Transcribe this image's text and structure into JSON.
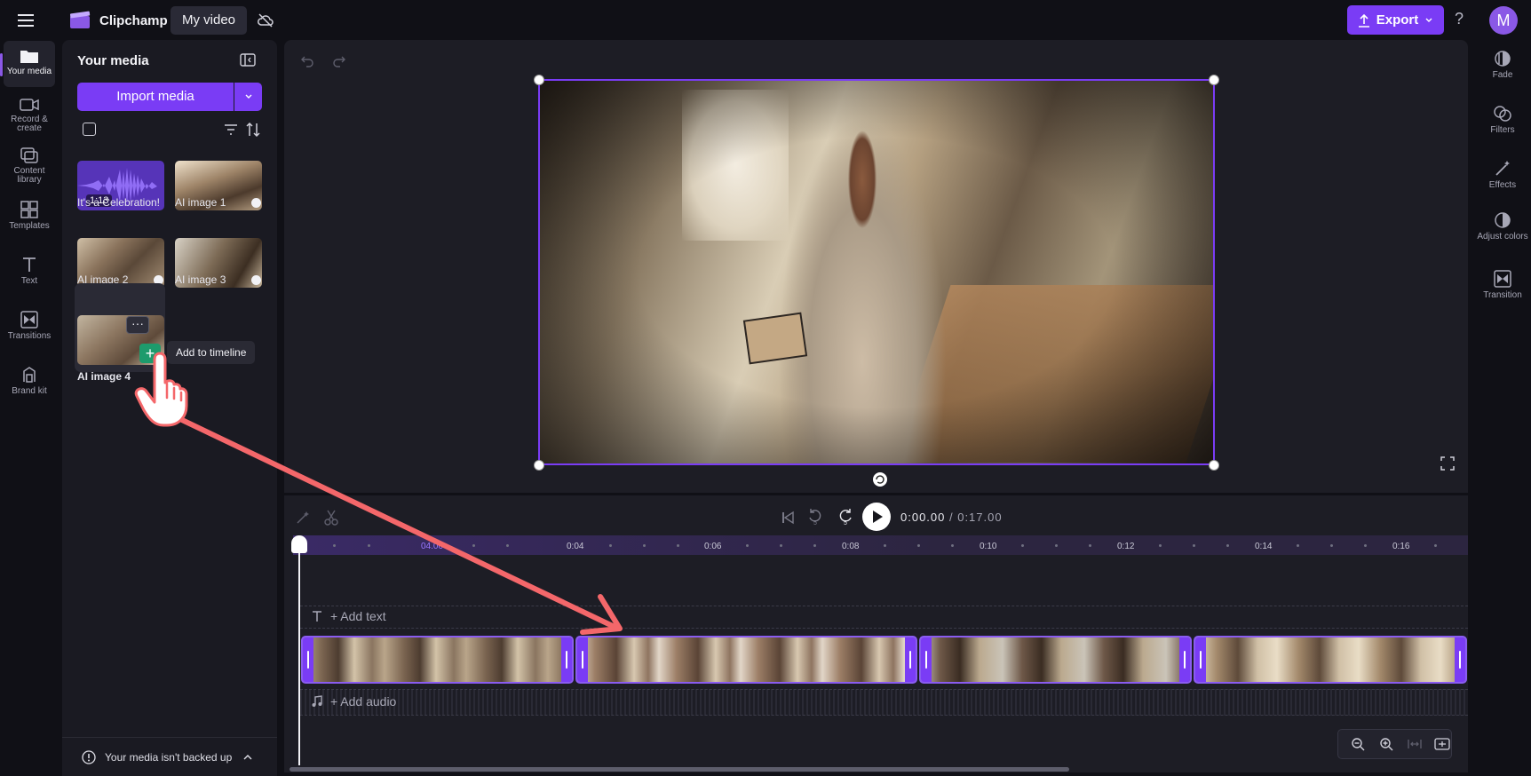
{
  "app": {
    "name": "Clipchamp",
    "project_title": "My video",
    "export_label": "Export",
    "help_glyph": "?",
    "avatar_initial": "M",
    "accent_color": "#7a3cf5"
  },
  "left_rail": {
    "items": [
      {
        "label": "Your media",
        "icon": "folder-icon",
        "active": true
      },
      {
        "label": "Record & create",
        "icon": "camera-icon"
      },
      {
        "label": "Content library",
        "icon": "library-icon"
      },
      {
        "label": "Templates",
        "icon": "templates-icon"
      },
      {
        "label": "Text",
        "icon": "text-icon"
      },
      {
        "label": "Transitions",
        "icon": "transitions-icon"
      },
      {
        "label": "Brand kit",
        "icon": "brand-kit-icon"
      }
    ]
  },
  "media_panel": {
    "title": "Your media",
    "import_label": "Import media",
    "items": [
      {
        "label": "It's a Celebration!",
        "duration": "1:13",
        "kind": "audio"
      },
      {
        "label": "AI image 1",
        "kind": "image",
        "used": true
      },
      {
        "label": "AI image 2",
        "kind": "image",
        "used": true
      },
      {
        "label": "AI image 3",
        "kind": "image",
        "used": true
      },
      {
        "label": "AI image 4",
        "kind": "image",
        "used": false
      }
    ],
    "more_glyph": "···",
    "plus_glyph": "+",
    "tooltip": "Add to timeline",
    "backup_notice": "Your media isn't backed up"
  },
  "right_rail": {
    "items": [
      {
        "label": "Fade",
        "icon": "fade-icon"
      },
      {
        "label": "Filters",
        "icon": "filters-icon"
      },
      {
        "label": "Effects",
        "icon": "effects-icon"
      },
      {
        "label": "Adjust colors",
        "icon": "adjust-colors-icon"
      },
      {
        "label": "Transition",
        "icon": "transition-icon"
      }
    ]
  },
  "playback": {
    "current_time": "0:00.00",
    "separator": " / ",
    "total_time": "0:17.00",
    "rewind_seconds": "5",
    "forward_seconds": "5"
  },
  "timeline": {
    "ruler_ticks": [
      "04.00",
      "0:04",
      "0:06",
      "0:08",
      "0:10",
      "0:12",
      "0:14",
      "0:16"
    ],
    "add_text_label": "+ Add text",
    "add_audio_label": "+ Add audio",
    "clips": [
      {
        "name": "AI image 1"
      },
      {
        "name": "AI image 4"
      },
      {
        "name": "AI image 3"
      },
      {
        "name": "AI image 2"
      }
    ]
  }
}
